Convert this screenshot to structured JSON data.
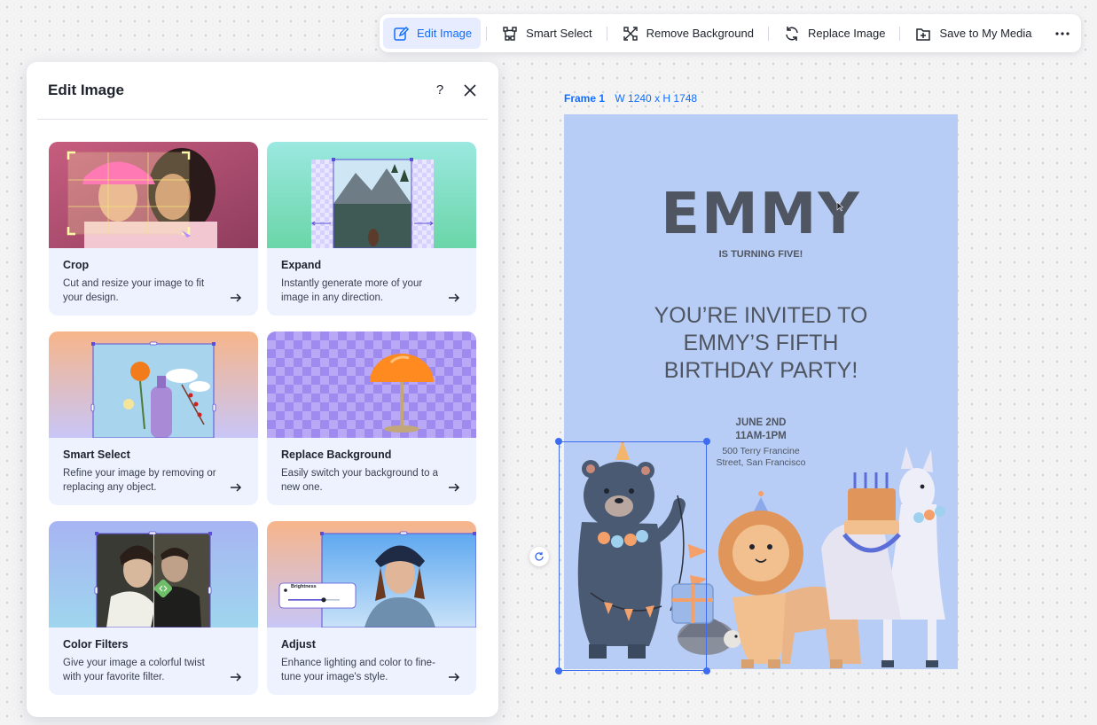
{
  "toolbar": {
    "items": [
      {
        "label": "Edit Image",
        "icon": "pencil-icon",
        "active": true
      },
      {
        "label": "Smart Select",
        "icon": "smart-select-icon"
      },
      {
        "label": "Remove Background",
        "icon": "remove-background-icon"
      },
      {
        "label": "Replace Image",
        "icon": "refresh-icon"
      },
      {
        "label": "Save to My Media",
        "icon": "save-media-icon"
      }
    ],
    "more_icon": "more-dots-icon",
    "accent": "#116dff"
  },
  "panel": {
    "title": "Edit Image",
    "help": "?",
    "cards": [
      {
        "title": "Crop",
        "desc": "Cut and resize your image to fit your design."
      },
      {
        "title": "Expand",
        "desc": "Instantly generate more of your image in any direction."
      },
      {
        "title": "Smart Select",
        "desc": "Refine your image by removing or replacing any object."
      },
      {
        "title": "Replace Background",
        "desc": "Easily switch your background to a new one."
      },
      {
        "title": "Color Filters",
        "desc": "Give your image a colorful twist with your favorite filter."
      },
      {
        "title": "Adjust",
        "desc": "Enhance lighting and color to fine-tune your image's style."
      }
    ],
    "adjust_chip": "Brightness"
  },
  "canvas": {
    "frame_name": "Frame 1",
    "frame_size": "W 1240 x H 1748",
    "invite": {
      "name": "EMMY",
      "subtitle": "IS TURNING FIVE!",
      "line1": "YOU’RE INVITED TO",
      "line2": "EMMY’S FIFTH",
      "line3": "BIRTHDAY PARTY!",
      "date": "JUNE 2ND",
      "time": "11AM-1PM",
      "address1": "500 Terry Francine",
      "address2": "Street, San Francisco"
    },
    "background": "#b8cdf5",
    "selection_color": "#3d6cf0"
  }
}
